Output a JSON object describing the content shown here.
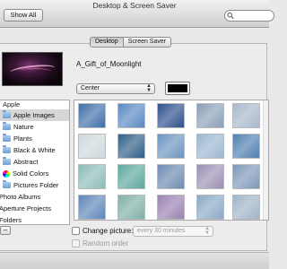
{
  "window": {
    "title": "Desktop & Screen Saver"
  },
  "toolbar": {
    "show_all_label": "Show All",
    "search_placeholder": "",
    "back_icon": "chevron-left-icon",
    "forward_icon": "chevron-right-icon"
  },
  "tabs": [
    {
      "label": "Desktop",
      "active": true
    },
    {
      "label": "Screen Saver",
      "active": false
    }
  ],
  "current": {
    "picture_name": "A_Gift_of_Moonlight",
    "fit_option": "Center",
    "background_color": "#000000"
  },
  "sources": {
    "header": "Apple",
    "items": [
      {
        "label": "Apple Images",
        "icon": "folder-icon",
        "selected": true
      },
      {
        "label": "Nature",
        "icon": "folder-icon"
      },
      {
        "label": "Plants",
        "icon": "folder-icon"
      },
      {
        "label": "Black & White",
        "icon": "folder-icon"
      },
      {
        "label": "Abstract",
        "icon": "folder-icon"
      },
      {
        "label": "Solid Colors",
        "icon": "color-wheel-icon"
      },
      {
        "label": "Pictures Folder",
        "icon": "folder-icon"
      }
    ],
    "extra": [
      "Photo Albums",
      "Aperture Projects",
      "Folders"
    ],
    "remove_label": "–"
  },
  "thumbnails": {
    "colors": [
      [
        "#3f6fa8",
        "#5a88c2",
        "#2c4f8c",
        "#8a9fb8",
        "#a9b8cc"
      ],
      [
        "#cfd8dc",
        "#2f5e86",
        "#6c93c0",
        "#9bb7d0",
        "#4f7fb0"
      ],
      [
        "#8dbcb6",
        "#5da89d",
        "#6d8ab2",
        "#9c8fb4",
        "#7d98b8"
      ],
      [
        "#5d86b8",
        "#7fb0a8",
        "#9a82b2",
        "#8ba9c6",
        "#a0b4c8"
      ]
    ]
  },
  "controls": {
    "change_picture_label": "Change picture:",
    "interval_value": "every 30 minutes",
    "random_order_label": "Random order"
  }
}
